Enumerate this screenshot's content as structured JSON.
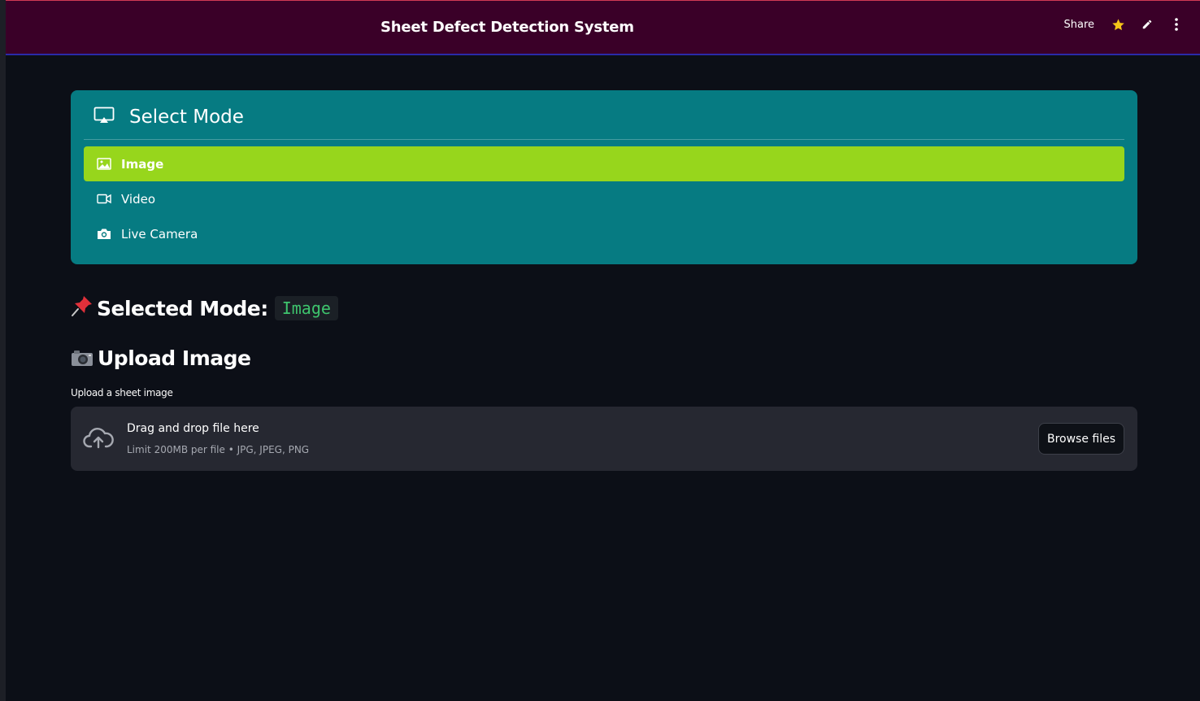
{
  "header": {
    "title": "Sheet Defect Detection System",
    "share_label": "Share",
    "icons": [
      "star-icon",
      "pencil-icon",
      "more-vert-icon"
    ]
  },
  "mode_selector": {
    "title": "Select Mode",
    "title_icon": "cast-screen-icon",
    "options": [
      {
        "label": "Image",
        "icon": "image-icon",
        "selected": true
      },
      {
        "label": "Video",
        "icon": "video-camera-icon",
        "selected": false
      },
      {
        "label": "Live Camera",
        "icon": "camera-icon",
        "selected": false
      }
    ]
  },
  "selected_mode": {
    "emoji": "📌",
    "label": "Selected Mode:",
    "value": "Image"
  },
  "upload": {
    "heading": "Upload Image",
    "heading_icon": "camera-icon",
    "field_label": "Upload a sheet image",
    "drop_text": "Drag and drop file here",
    "limit_text": "Limit 200MB per file • JPG, JPEG, PNG",
    "browse_label": "Browse files",
    "upload_icon": "cloud-upload-icon"
  },
  "colors": {
    "header_bg": "#3a0028",
    "card_bg": "#067b82",
    "selected_option_bg": "#97d61c",
    "page_bg": "#0c0f17",
    "code_text": "#3ec46d",
    "star": "#f5c518"
  }
}
